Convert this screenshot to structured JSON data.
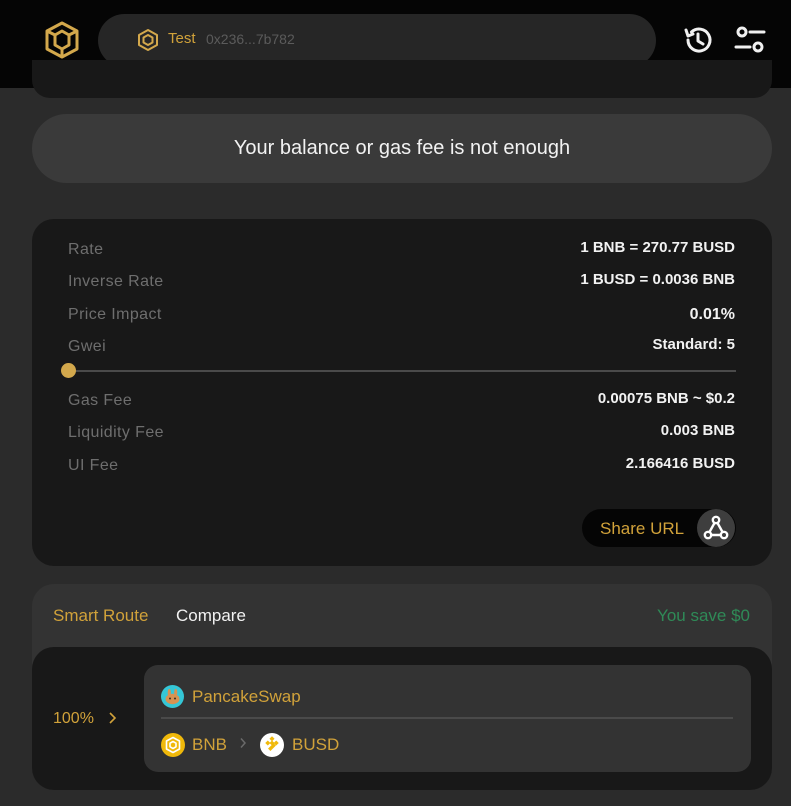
{
  "header": {
    "wallet_name": "Test",
    "wallet_address": "0x236...7b782",
    "icons": {
      "logo": "bnb-logo",
      "history": "history-icon",
      "settings": "settings-sliders-icon"
    }
  },
  "balance_warning": "Your balance or gas fee is not enough",
  "details": {
    "rows": [
      {
        "label": "Rate",
        "value": "1 BNB = 270.77 BUSD"
      },
      {
        "label": "Inverse Rate",
        "value": "1 BUSD = 0.0036 BNB"
      },
      {
        "label": "Price Impact",
        "value": "0.01%"
      },
      {
        "label": "Gwei",
        "value": "Standard: 5"
      },
      {
        "label": "Gas Fee",
        "value": "0.00075 BNB ~ $0.2"
      },
      {
        "label": "Liquidity Fee",
        "value": "0.003 BNB"
      },
      {
        "label": "UI Fee",
        "value": "2.166416 BUSD"
      }
    ],
    "gwei_slider_fraction": 0.0,
    "share_label": "Share URL"
  },
  "route": {
    "tab_smart": "Smart Route",
    "tab_compare": "Compare",
    "you_save": "You save $0",
    "percent": "100%",
    "pool_name": "PancakeSwap",
    "token_from": "BNB",
    "token_to": "BUSD"
  },
  "colors": {
    "accent": "#d1a23a",
    "save_green": "#2f8a57",
    "background": "#2b2b2b",
    "card": "#181818"
  }
}
